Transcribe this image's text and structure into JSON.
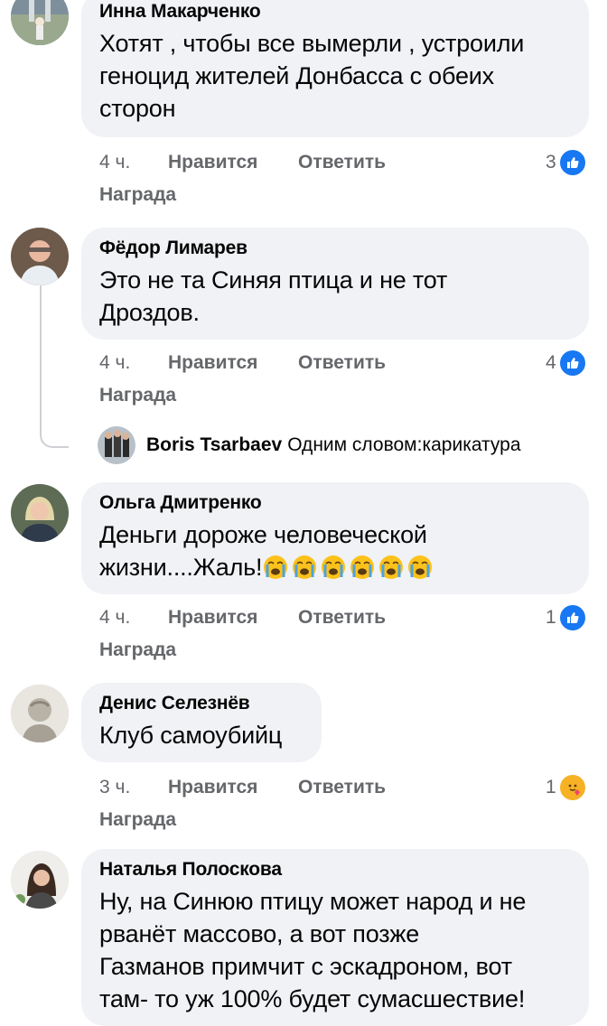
{
  "comments": [
    {
      "name": "Инна Макарченко",
      "lines": [
        "Хотят , чтобы все вымерли , устроили",
        "геноцид жителей Донбасса с обеих",
        "сторон"
      ],
      "time": "4 ч.",
      "like": "Нравится",
      "reply": "Ответить",
      "award": "Награда",
      "count": "3",
      "reaction": "like-icon"
    },
    {
      "name": "Фёдор Лимарев",
      "lines": [
        "Это не та Синяя птица и не тот",
        "Дроздов."
      ],
      "time": "4 ч.",
      "like": "Нравится",
      "reply": "Ответить",
      "award": "Награда",
      "count": "4",
      "reaction": "like-icon"
    },
    {
      "name": "Ольга Дмитренко",
      "lines": [
        "Деньги дороже человеческой",
        "жизни....Жаль!"
      ],
      "time": "4 ч.",
      "like": "Нравится",
      "reply": "Ответить",
      "award": "Награда",
      "count": "1",
      "reaction": "like-icon"
    },
    {
      "name": "Денис Селезнёв",
      "lines": [
        "Клуб самоубийц"
      ],
      "time": "3 ч.",
      "like": "Нравится",
      "reply": "Ответить",
      "award": "Награда",
      "count": "1",
      "reaction": "care-icon"
    },
    {
      "name": "Наталья Полоскова",
      "lines": [
        "Ну, на Синюю птицу может народ и не",
        "рванёт массово, а вот позже",
        "Газманов примчит с эскадроном, вот",
        "там- то уж 100% будет сумасшествие!"
      ]
    }
  ],
  "reply_preview": {
    "name": "Boris Tsarbaev",
    "text": "Одним словом:карикатура"
  },
  "colors": {
    "bubble": "#f0f2f5",
    "meta": "#65676b",
    "like_blue": "#1877f2"
  }
}
